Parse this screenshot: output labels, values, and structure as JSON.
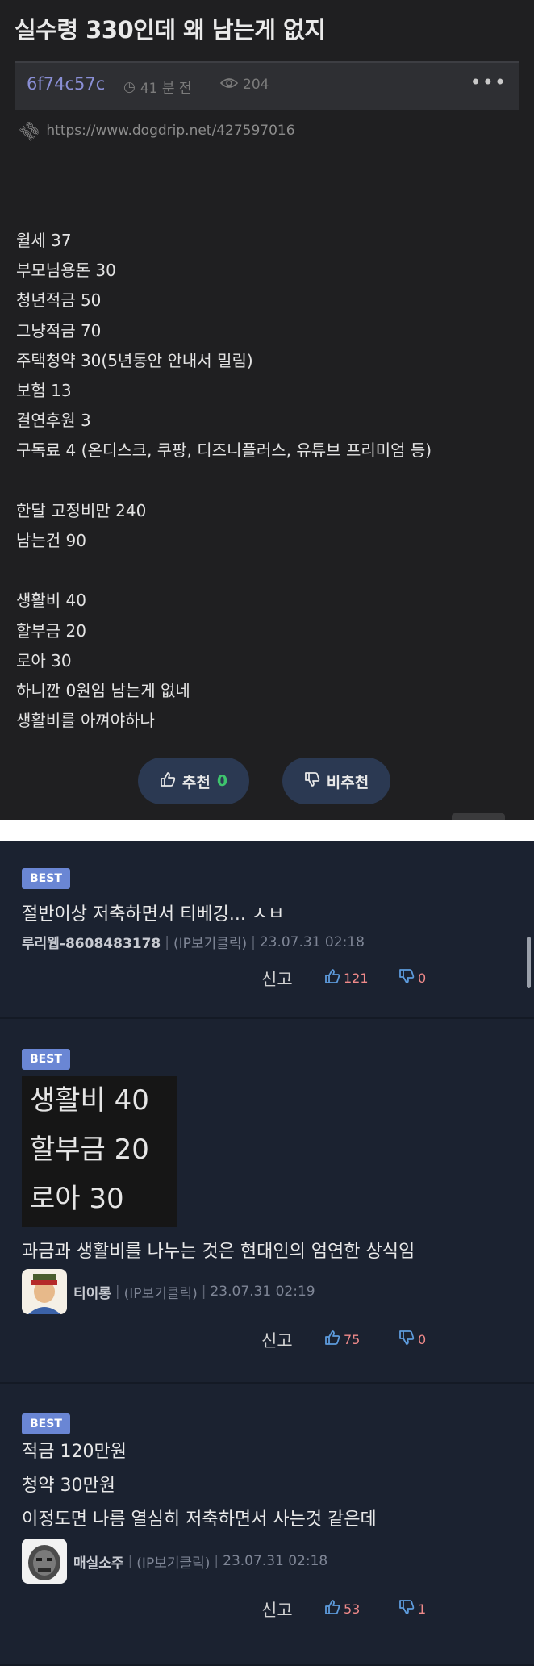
{
  "post": {
    "title": "실수령 330인데 왜 남는게 없지",
    "author": "6f74c57c",
    "time": "41 분 전",
    "views": "204",
    "more": "•••",
    "url": "https://www.dogdrip.net/427597016",
    "body": "월세 37\n부모님용돈 30\n청년적금 50\n그냥적금 70\n주택청약 30(5년동안 안내서 밀림)\n보험 13\n결연후원 3\n구독료 4 (온디스크, 쿠팡, 디즈니플러스, 유튜브 프리미엄 등)\n\n한달 고정비만 240\n남는건 90\n\n생활비 40\n할부금 20\n로아 30\n하니깐 0원임 남는게 없네\n생활비를 아껴야하나",
    "upvote_label": "추천",
    "upvote_count": "0",
    "downvote_label": "비추천"
  },
  "comments": [
    {
      "badge": "BEST",
      "text": "절반이상 저축하면서 티베깅... ㅅㅂ",
      "nick": "루리웹-8608483178",
      "ip": "(IP보기클릭)",
      "date": "23.07.31 02:18",
      "report": "신고",
      "likes": "121",
      "dislikes": "0"
    },
    {
      "badge": "BEST",
      "image_lines": "생활비 40\n할부금 20\n로아 30",
      "text": "과금과 생활비를 나누는 것은 현대인의 엄연한 상식임",
      "nick": "티이롱",
      "ip": "(IP보기클릭)",
      "date": "23.07.31 02:19",
      "report": "신고",
      "likes": "75",
      "dislikes": "0"
    },
    {
      "badge": "BEST",
      "text": "적금 120만원\n청약 30만원\n이정도면 나름 열심히 저축하면서 사는것 같은데",
      "nick": "매실소주",
      "ip": "(IP보기클릭)",
      "date": "23.07.31 02:18",
      "report": "신고",
      "likes": "53",
      "dislikes": "1"
    }
  ],
  "icons": {
    "clock": "clock-icon",
    "eye": "eye-icon",
    "link": "link-icon",
    "thumbs_up": "thumbs-up-icon",
    "thumbs_down": "thumbs-down-icon"
  }
}
